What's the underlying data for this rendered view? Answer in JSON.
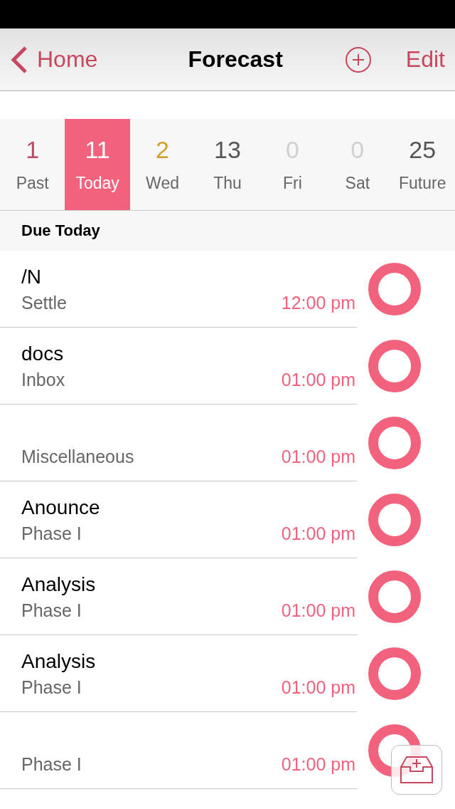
{
  "nav": {
    "back": "Home",
    "title": "Forecast",
    "edit": "Edit"
  },
  "days": [
    {
      "count": "1",
      "label": "Past",
      "selected": false,
      "color": "#c2485f"
    },
    {
      "count": "11",
      "label": "Today",
      "selected": true,
      "color": "#ffffff"
    },
    {
      "count": "2",
      "label": "Wed",
      "selected": false,
      "color": "#d19f2c"
    },
    {
      "count": "13",
      "label": "Thu",
      "selected": false,
      "color": "#555555"
    },
    {
      "count": "0",
      "label": "Fri",
      "selected": false,
      "color": "#d0d0d0"
    },
    {
      "count": "0",
      "label": "Sat",
      "selected": false,
      "color": "#d0d0d0"
    },
    {
      "count": "25",
      "label": "Future",
      "selected": false,
      "color": "#555555"
    }
  ],
  "section": "Due Today",
  "tasks": [
    {
      "title": "/N",
      "project": "Settle",
      "due": "12:00 pm",
      "done": false
    },
    {
      "title": "docs",
      "project": "Inbox",
      "due": "01:00 pm",
      "done": false
    },
    {
      "project": "Miscellaneous",
      "due": "01:00 pm",
      "done": false
    },
    {
      "title": "Anounce",
      "project": "Phase I",
      "due": "01:00 pm",
      "done": false
    },
    {
      "title": "Analysis",
      "project": "Phase I",
      "due": "01:00 pm",
      "done": false
    },
    {
      "title": "Analysis",
      "project": "Phase I",
      "due": "01:00 pm",
      "done": false
    },
    {
      "project": "Phase I",
      "due": "01:00 pm",
      "done": false
    }
  ]
}
